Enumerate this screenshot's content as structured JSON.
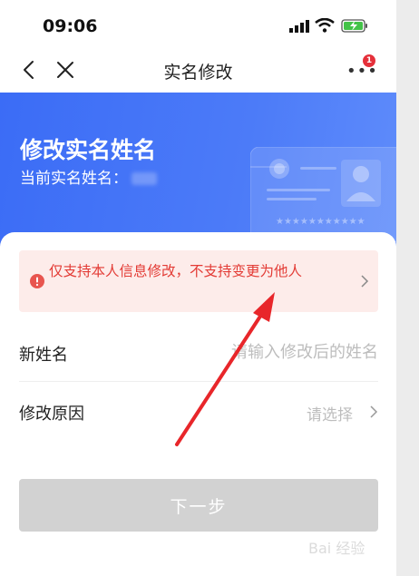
{
  "status_bar": {
    "time": "09:06"
  },
  "nav": {
    "title": "实名修改",
    "badge_count": "1"
  },
  "hero": {
    "title": "修改实名姓名",
    "current_name_label": "当前实名姓名："
  },
  "notice": {
    "text": "仅支持本人信息修改，不支持变更为他人"
  },
  "form": {
    "new_name_label": "新姓名",
    "new_name_placeholder": "请输入修改后的姓名",
    "reason_label": "修改原因",
    "reason_select_text": "请选择"
  },
  "actions": {
    "next_label": "下一步"
  },
  "colors": {
    "hero_blue": "#4070f4",
    "alert_red": "#e33b35",
    "notice_bg": "#fdecea",
    "button_disabled": "#d2d2d2",
    "annotation_arrow": "#e8262a"
  },
  "watermark": {
    "text": "Bai 经验"
  }
}
